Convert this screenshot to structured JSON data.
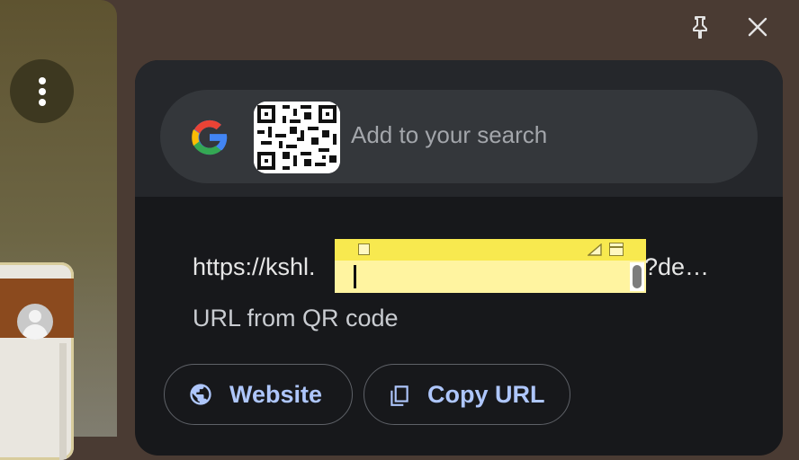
{
  "top_controls": {
    "pin_icon": "pin-icon",
    "close_icon": "close-icon"
  },
  "background": {
    "menu_icon": "more-vertical-icon",
    "avatar_icon": "avatar-icon"
  },
  "search": {
    "placeholder": "Add to your search",
    "logo_icon": "google-logo-icon",
    "thumbnail": "qr-code-thumbnail"
  },
  "result": {
    "url_start": "https://kshl.",
    "url_end": "?de…",
    "caption": "URL from QR code"
  },
  "actions": [
    {
      "label": "Website",
      "icon": "globe-icon"
    },
    {
      "label": "Copy URL",
      "icon": "copy-icon"
    }
  ],
  "colors": {
    "panel": "#17181b",
    "header": "#25272b",
    "search_bg": "#34373b",
    "accent": "#aec6fb",
    "sticky_note": "#fff4a0"
  }
}
